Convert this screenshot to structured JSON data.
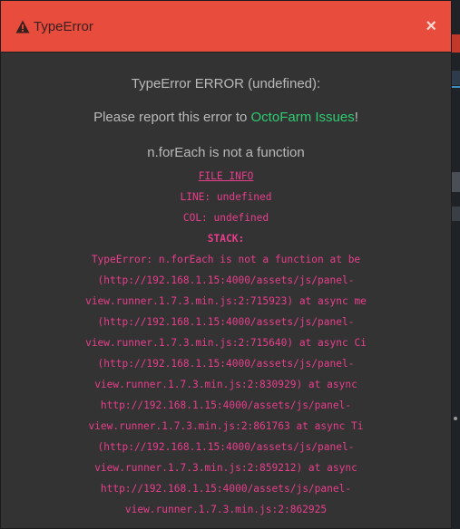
{
  "modal": {
    "title": "TypeError",
    "close_label": "×",
    "error_heading": "TypeError ERROR (undefined):",
    "report_prefix": "Please report this error to ",
    "report_link": "OctoFarm Issues",
    "report_suffix": "!",
    "message": "n.forEach is not a function",
    "file_info": "FILE INFO",
    "line": "LINE: undefined",
    "col": "COL: undefined",
    "stack_label": "STACK:",
    "stack_text": "TypeError: n.forEach is not a function at be (http://192.168.1.15:4000/assets/js/panel-view.runner.1.7.3.min.js:2:715923) at async me (http://192.168.1.15:4000/assets/js/panel-view.runner.1.7.3.min.js:2:715640) at async Ci (http://192.168.1.15:4000/assets/js/panel-view.runner.1.7.3.min.js:2:830929) at async http://192.168.1.15:4000/assets/js/panel-view.runner.1.7.3.min.js:2:861763 at async Ti (http://192.168.1.15:4000/assets/js/panel-view.runner.1.7.3.min.js:2:859212) at async http://192.168.1.15:4000/assets/js/panel-view.runner.1.7.3.min.js:2:862925"
  },
  "colors": {
    "header": "#e74c3c",
    "body": "#333333",
    "link": "#2ecc71",
    "code": "#e83e8c"
  },
  "icons": {
    "title_icon": "warning-triangle-icon",
    "close_icon": "close-icon"
  }
}
